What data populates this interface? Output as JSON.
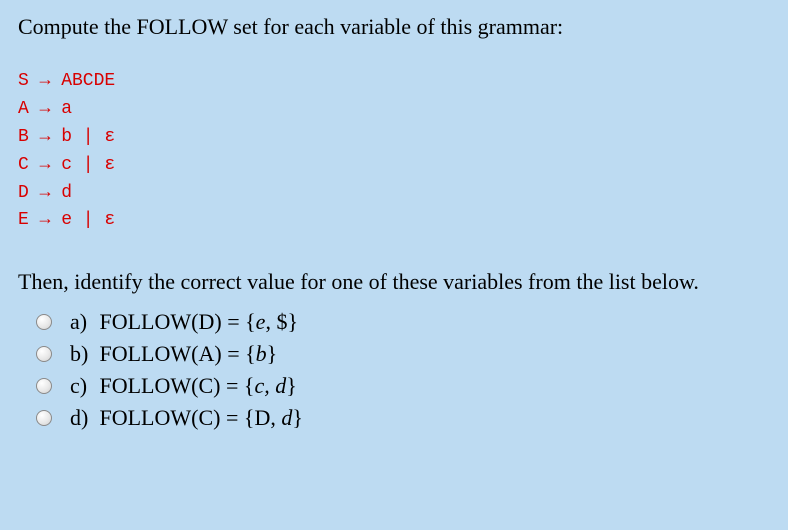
{
  "question": {
    "intro": "Compute the FOLLOW set for each variable of this grammar:",
    "followup": "Then, identify the correct value for one of these variables from the list below."
  },
  "grammar": {
    "lines": [
      "S → ABCDE",
      "A → a",
      "B → b | ε",
      "C → c | ε",
      "D → d",
      "E → e | ε"
    ]
  },
  "options": [
    {
      "letter": "a)",
      "text_before": "FOLLOW(D) = {",
      "italic": "e",
      "text_after": ", $}"
    },
    {
      "letter": "b)",
      "text_before": "FOLLOW(A) = {",
      "italic": "b",
      "text_after": "}"
    },
    {
      "letter": "c)",
      "text_before": "FOLLOW(C) = {",
      "italic": "c, d",
      "text_after": "}"
    },
    {
      "letter": "d)",
      "text_before": "FOLLOW(C) = {D, ",
      "italic": "d",
      "text_after": "}"
    }
  ]
}
